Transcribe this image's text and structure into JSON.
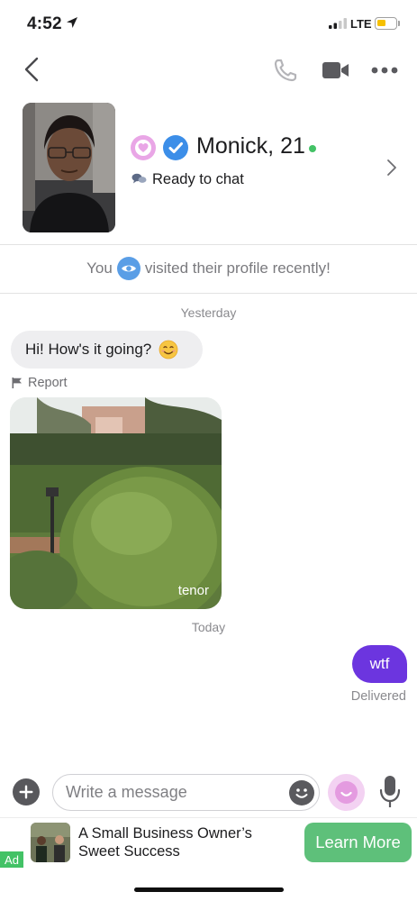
{
  "status_bar": {
    "time": "4:52",
    "network": "LTE",
    "battery_fraction": 0.45,
    "battery_color": "#f6c000"
  },
  "nav": {
    "back_icon": "chevron-left-icon",
    "call_icon": "phone-icon",
    "video_icon": "video-camera-icon",
    "more_icon": "more-horizontal-icon"
  },
  "profile": {
    "name": "Monick, 21",
    "status": "Ready to chat",
    "online": true,
    "online_color": "#43c266",
    "heart_badge_color": "#e9a6e6",
    "verified_badge_color": "#3c8ee8"
  },
  "visited_notice": {
    "prefix": "You",
    "suffix": "visited their profile recently!"
  },
  "messages": {
    "yesterday_label": "Yesterday",
    "incoming_text": "Hi! How's it going?",
    "report_label": "Report",
    "gif_watermark": "tenor",
    "today_label": "Today",
    "outgoing_text": "wtf",
    "outgoing_color": "#6c35df",
    "delivered_label": "Delivered"
  },
  "composer": {
    "placeholder": "Write a message"
  },
  "ad": {
    "tag": "Ad",
    "headline": "A Small Business Owner’s Sweet Success",
    "cta": "Learn More",
    "cta_color": "#5ec07a"
  }
}
